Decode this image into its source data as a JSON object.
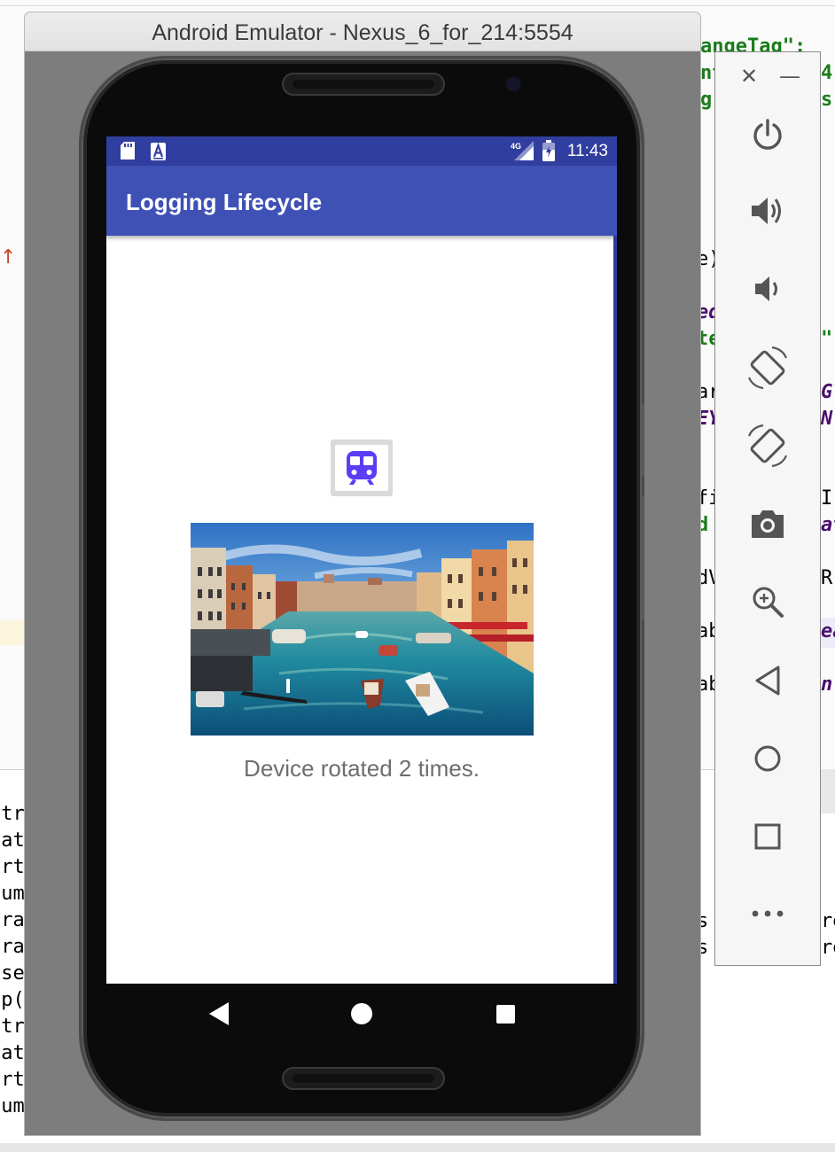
{
  "emulator": {
    "title": "Android Emulator - Nexus_6_for_214:5554"
  },
  "status_bar": {
    "time": "11:43",
    "network": "4G",
    "icons": [
      "sd-card-icon",
      "font-a-icon",
      "signal-4g-icon",
      "battery-icon"
    ]
  },
  "app": {
    "title": "Logging Lifecycle",
    "icon": "train-icon",
    "photo": "venice-grand-canal-photo",
    "rotation_text": "Device rotated 2 times."
  },
  "nav_bar": {
    "buttons": [
      "back-icon",
      "home-icon",
      "recents-icon"
    ]
  },
  "toolbar": {
    "buttons": [
      "close-icon",
      "minimize-icon",
      "power-icon",
      "volume-up-icon",
      "volume-down-icon",
      "rotate-left-icon",
      "rotate-right-icon",
      "camera-icon",
      "zoom-icon",
      "back-icon",
      "home-icon",
      "overview-icon",
      "more-icon"
    ]
  },
  "ide_code": {
    "top_right": [
      "angeTag\":",
      "nt",
      "gr",
      "4",
      "s"
    ],
    "right_col": [
      "e)",
      "ed",
      "te",
      "\"",
      "ar",
      "EY",
      "Gl",
      "N.",
      "fi",
      "d",
      "I(",
      "at",
      "dV",
      "R",
      "ab",
      "ea",
      "ab",
      "n."
    ],
    "bottom_right": [
      "s",
      "s",
      "re",
      "re"
    ],
    "bottom_left": [
      "str",
      "eat",
      "art",
      "sum",
      "fra",
      "fra",
      "use",
      "op(",
      "str",
      "eat",
      "art",
      "sum"
    ]
  },
  "colors": {
    "status_bar": "#303f9f",
    "app_bar": "#3f51b5",
    "train_icon": "#5b3df5"
  }
}
